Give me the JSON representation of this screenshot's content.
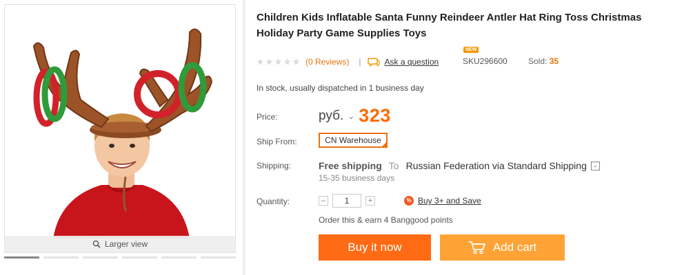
{
  "product": {
    "title": "Children Kids Inflatable Santa Funny Reindeer Antler Hat Ring Toss Christmas Holiday Party Game Supplies Toys",
    "rating": 0,
    "reviews_text": "(0 Reviews)",
    "separator": "|",
    "ask_question": "Ask a question",
    "new_badge": "NEW",
    "sku": "SKU296600",
    "sold_label": "Sold:",
    "sold_value": "35",
    "stock_status": "In stock, usually dispatched in 1 business day"
  },
  "gallery": {
    "larger_view": "Larger view",
    "thumbnail_count": 6,
    "active_thumbnail": 1
  },
  "price": {
    "label": "Price:",
    "currency": "руб.",
    "chevron": "⌄",
    "value": "323"
  },
  "ship_from": {
    "label": "Ship From:",
    "value": "CN Warehouse",
    "check": "✓"
  },
  "shipping": {
    "label": "Shipping:",
    "free": "Free shipping",
    "to": "To",
    "destination": "Russian Federation via Standard Shipping",
    "toggle": "⌄",
    "days": "15-35 business days"
  },
  "quantity": {
    "label": "Quantity:",
    "minus": "–",
    "value": "1",
    "plus": "+",
    "pct_icon": "%",
    "save_link": "Buy 3+ and Save",
    "points_note": "Order this & earn 4 Banggood points"
  },
  "actions": {
    "buy_now": "Buy it now",
    "add_cart": "Add cart"
  },
  "colors": {
    "accent_orange": "#ff6a00",
    "buy_now_bg": "#ff6a13",
    "add_cart_bg": "#ffa336",
    "warehouse_border": "#e8730f"
  },
  "icons": [
    "search-icon",
    "chat-bubble-icon",
    "percent-icon",
    "cart-icon",
    "chevron-down-icon",
    "checkmark-icon",
    "star-icon"
  ]
}
